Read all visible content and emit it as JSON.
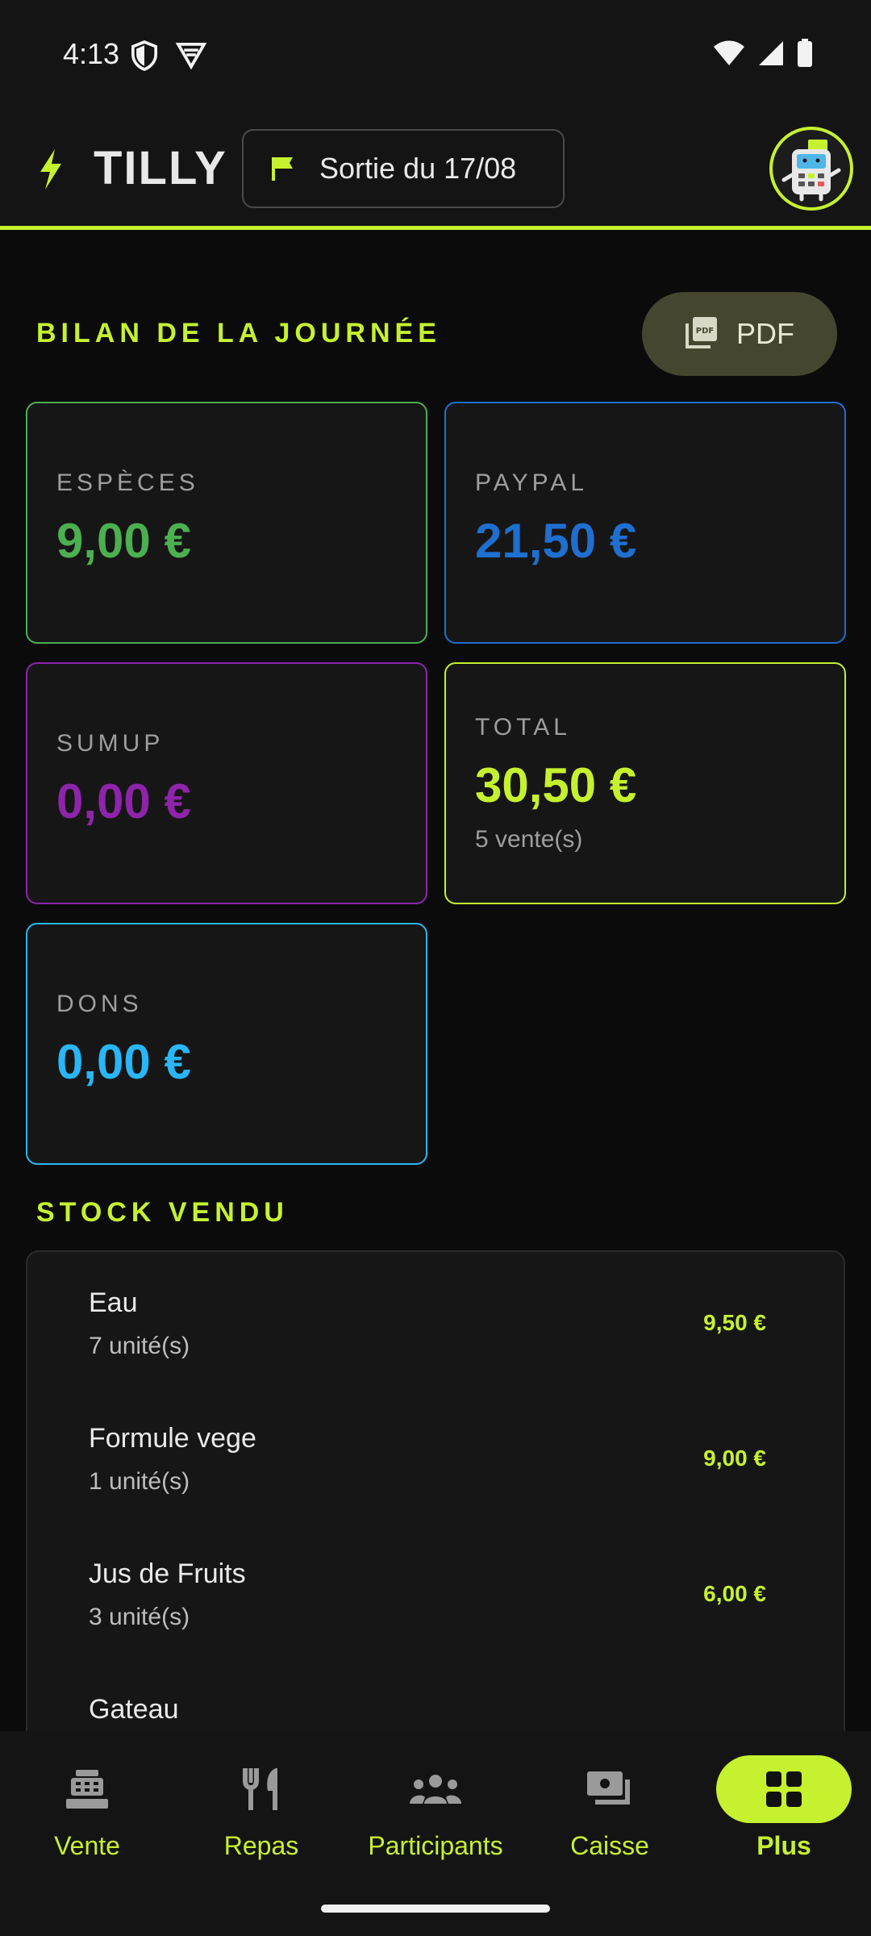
{
  "status_bar": {
    "time": "4:13"
  },
  "header": {
    "title": "TILLY",
    "session_label": "Sortie du 17/08"
  },
  "summary": {
    "title": "BILAN DE LA JOURNÉE",
    "pdf_label": "PDF",
    "cards": [
      {
        "caption": "ESPÈCES",
        "amount": "9,00 €",
        "color": "#4caf50"
      },
      {
        "caption": "PAYPAL",
        "amount": "21,50 €",
        "color": "#1e6fd0"
      },
      {
        "caption": "SUMUP",
        "amount": "0,00 €",
        "color": "#8e24aa"
      },
      {
        "caption": "TOTAL",
        "amount": "30,50 €",
        "sub": "5 vente(s)",
        "color": "#c6f12f"
      },
      {
        "caption": "DONS",
        "amount": "0,00 €",
        "color": "#29b6f6"
      }
    ]
  },
  "stock": {
    "title": "STOCK VENDU",
    "items": [
      {
        "name": "Eau",
        "qty": "7 unité(s)",
        "price": "9,50 €"
      },
      {
        "name": "Formule vege",
        "qty": "1 unité(s)",
        "price": "9,00 €"
      },
      {
        "name": "Jus de Fruits",
        "qty": "3 unité(s)",
        "price": "6,00 €"
      },
      {
        "name": "Gateau",
        "qty": "",
        "price": ""
      }
    ]
  },
  "nav": {
    "items": [
      {
        "label": "Vente",
        "icon": "cash-register-icon"
      },
      {
        "label": "Repas",
        "icon": "utensils-icon"
      },
      {
        "label": "Participants",
        "icon": "group-icon"
      },
      {
        "label": "Caisse",
        "icon": "payments-icon"
      },
      {
        "label": "Plus",
        "icon": "grid-icon",
        "active": true
      }
    ]
  },
  "colors": {
    "accent": "#c6f12f",
    "background": "#0b0b0b",
    "surface": "#161616"
  }
}
